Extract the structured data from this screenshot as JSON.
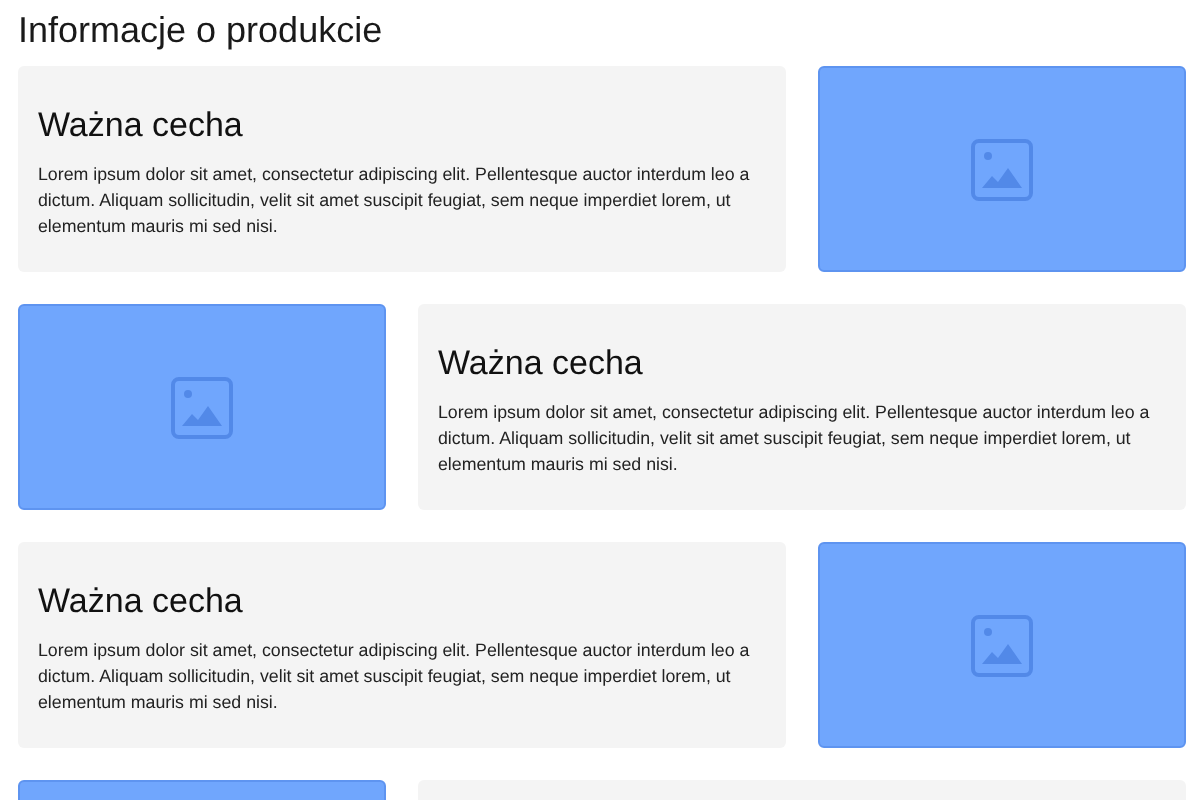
{
  "page": {
    "title": "Informacje o produkcie"
  },
  "features": [
    {
      "kind": "text",
      "icon": true,
      "title": "Ważna cecha",
      "body": "Lorem ipsum dolor sit amet, consectetur adipiscing elit. Pellentesque auctor interdum leo a dictum. Aliquam sollicitudin, velit sit amet suscipit feugiat, sem neque imperdiet lorem, ut elementum mauris mi sed nisi."
    },
    {
      "kind": "image",
      "icon": true,
      "title": "Ważna cecha",
      "body": "Lorem ipsum dolor sit amet, consectetur adipiscing elit. Pellentesque auctor interdum leo a dictum. Aliquam sollicitudin, velit sit amet suscipit feugiat, sem neque imperdiet lorem, ut elementum mauris mi sed nisi."
    },
    {
      "kind": "text",
      "icon": true,
      "title": "Ważna cecha",
      "body": "Lorem ipsum dolor sit amet, consectetur adipiscing elit. Pellentesque auctor interdum leo a dictum. Aliquam sollicitudin, velit sit amet suscipit feugiat, sem neque imperdiet lorem, ut elementum mauris mi sed nisi."
    },
    {
      "kind": "image"
    }
  ]
}
